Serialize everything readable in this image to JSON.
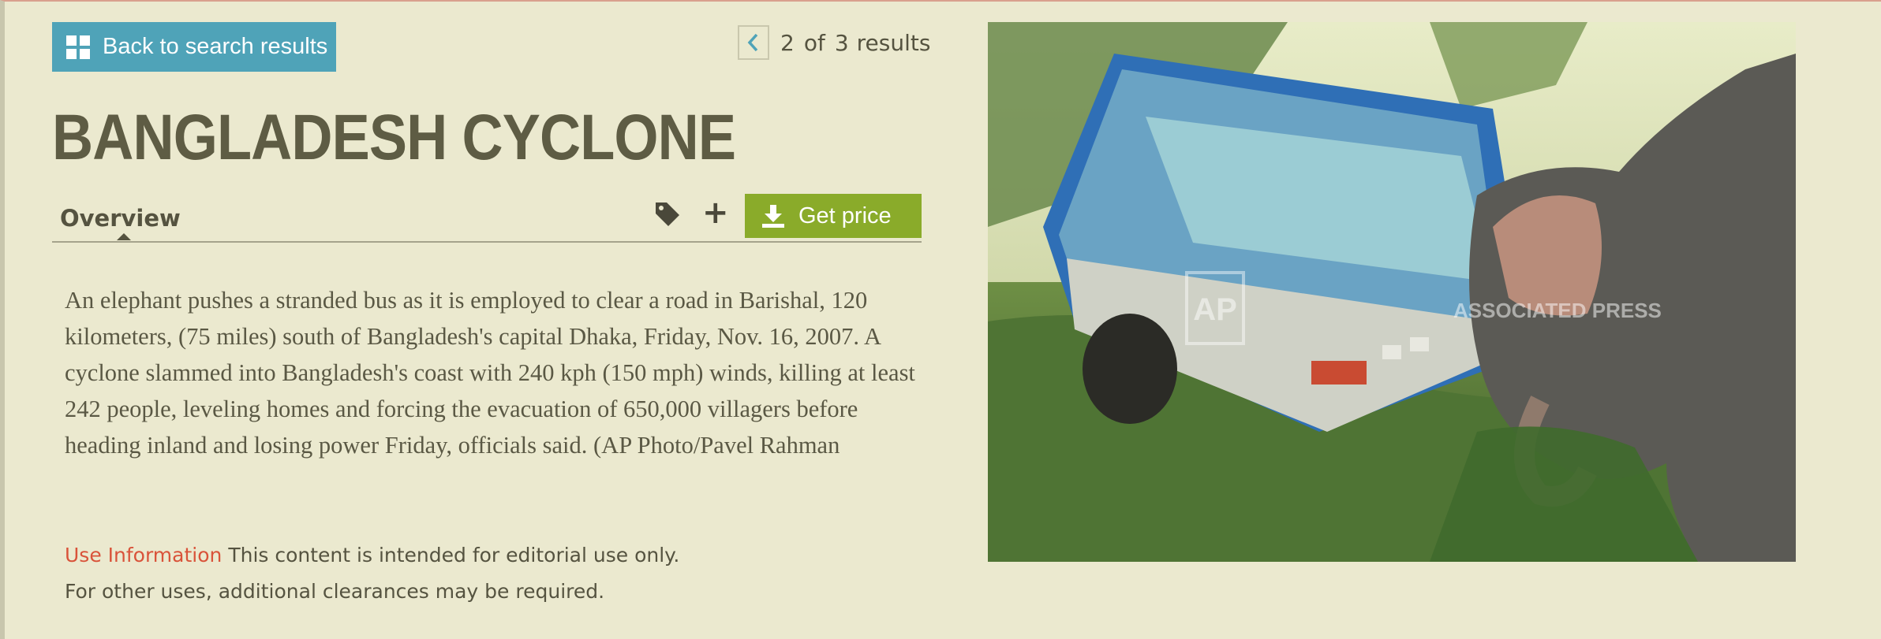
{
  "nav": {
    "back_label": "Back to search results",
    "pager": {
      "current": "2",
      "of": "of",
      "total": "3",
      "unit": "results"
    }
  },
  "title": "BANGLADESH CYCLONE",
  "tabs": {
    "overview": "Overview",
    "get_price": "Get price"
  },
  "description": "An elephant pushes a stranded bus as it is employed to clear a road in Barishal, 120 kilometers, (75 miles) south of Bangladesh's capital Dhaka, Friday, Nov. 16, 2007. A cyclone slammed into Bangladesh's coast with 240 kph (150 mph) winds, killing at least 242 people, leveling homes and forcing the evacuation of 650,000 villagers before heading inland and losing power Friday, officials said. (AP Photo/Pavel Rahman",
  "use_info": {
    "label": "Use Information",
    "line1": "This content is intended for editorial use only.",
    "line2": "For other uses, additional clearances may be required."
  },
  "photo": {
    "watermark_badge": "AP",
    "watermark_text": "ASSOCIATED PRESS"
  },
  "colors": {
    "background": "#ebe9cf",
    "back_button": "#4fa3b8",
    "get_price_button": "#8aab2a",
    "title": "#5e5c44",
    "use_info_label": "#d9533a"
  },
  "icons": [
    "grid-icon",
    "chevron-left-icon",
    "tag-icon",
    "plus-icon",
    "download-icon"
  ]
}
